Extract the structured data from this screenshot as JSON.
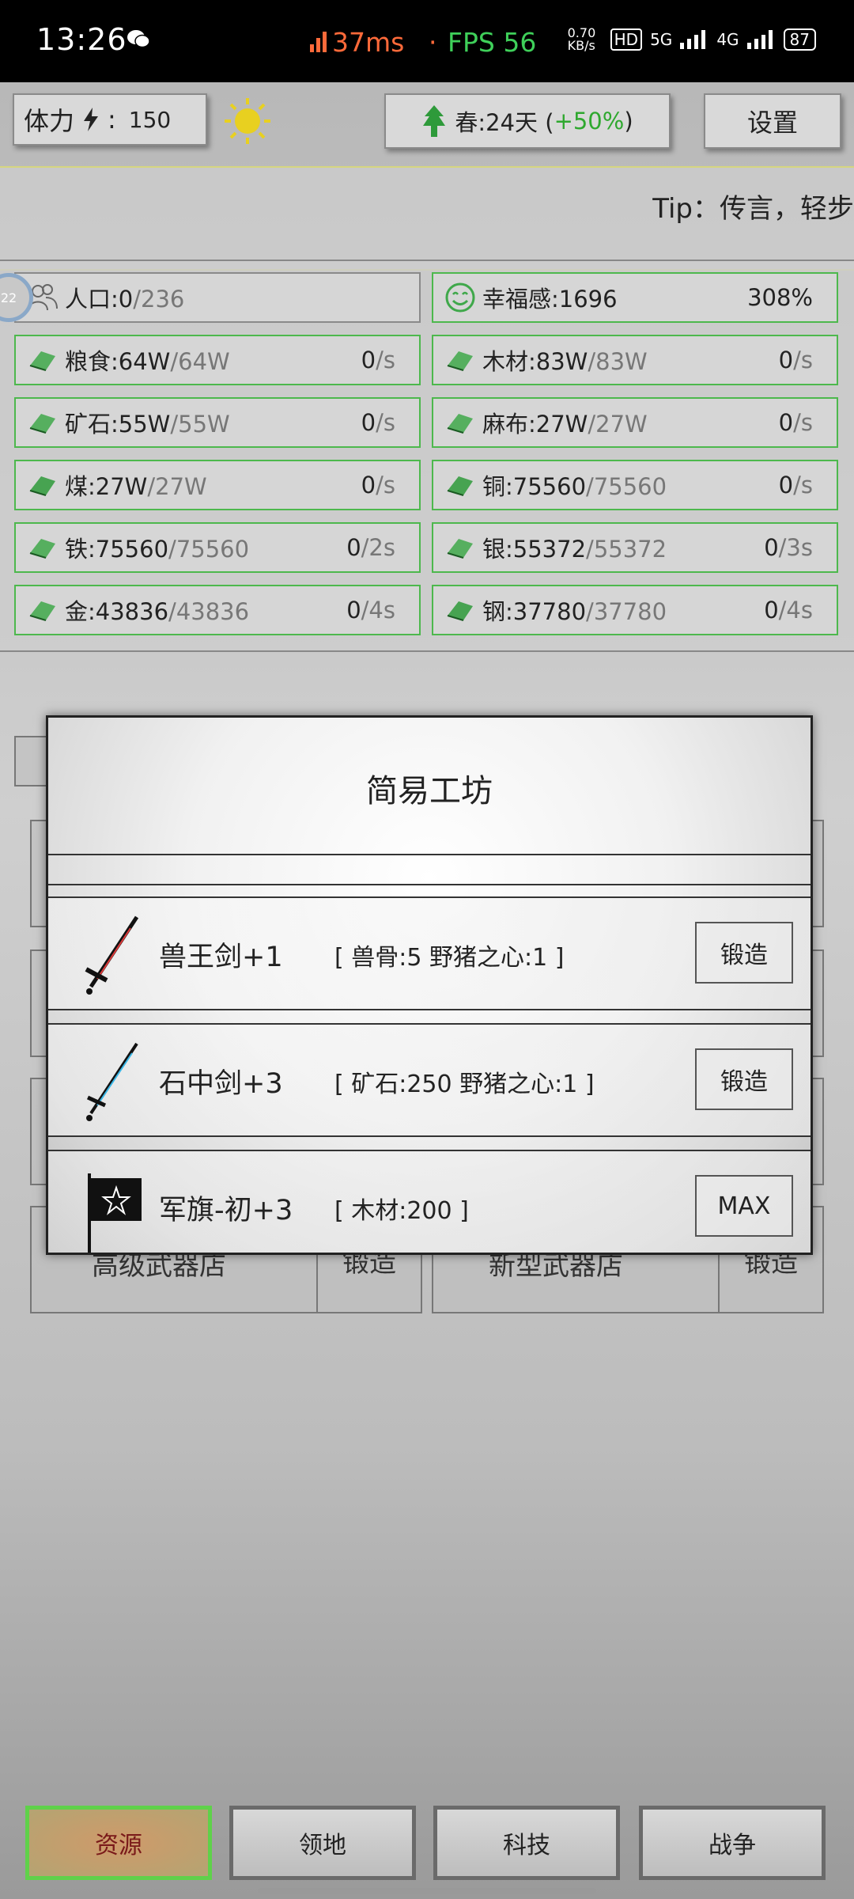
{
  "status_bar": {
    "time": "13:26",
    "ping": "37ms",
    "separator": "·",
    "fps": "FPS 56",
    "net_speed": "0.70 KB/s",
    "hd": "HD",
    "sim1": "5G",
    "sim2": "4G",
    "battery": "87"
  },
  "top": {
    "stamina_label": "体力",
    "stamina_sep": ":",
    "stamina_value": "150",
    "season_label": "春:24天 (",
    "season_bonus": "+50%",
    "season_close": ")",
    "settings": "设置"
  },
  "tip": "Tip：传言，轻步",
  "badge": "22",
  "resources_left": [
    {
      "name": "人口:",
      "cur": "0",
      "max": "/236",
      "rate": "",
      "unit": "",
      "icon": "people-icon"
    },
    {
      "name": "粮食:",
      "cur": "64W",
      "max": "/64W",
      "rate": "0",
      "unit": "/s",
      "icon": "meat-icon"
    },
    {
      "name": "矿石:",
      "cur": "55W",
      "max": "/55W",
      "rate": "0",
      "unit": "/s",
      "icon": "ore-icon"
    },
    {
      "name": "煤:",
      "cur": "27W",
      "max": "/27W",
      "rate": "0",
      "unit": "/s",
      "icon": "coal-icon"
    },
    {
      "name": "铁:",
      "cur": "75560",
      "max": "/75560",
      "rate": "0",
      "unit": "/2s",
      "icon": "iron-icon"
    },
    {
      "name": "金:",
      "cur": "43836",
      "max": "/43836",
      "rate": "0",
      "unit": "/4s",
      "icon": "gold-icon"
    }
  ],
  "resources_right": [
    {
      "name": "幸福感:",
      "cur": "1696",
      "max": "",
      "rate": "308%",
      "unit": "",
      "icon": "smile-icon"
    },
    {
      "name": "木材:",
      "cur": "83W",
      "max": "/83W",
      "rate": "0",
      "unit": "/s",
      "icon": "wood-icon"
    },
    {
      "name": "麻布:",
      "cur": "27W",
      "max": "/27W",
      "rate": "0",
      "unit": "/s",
      "icon": "linen-icon"
    },
    {
      "name": "铜:",
      "cur": "75560",
      "max": "/75560",
      "rate": "0",
      "unit": "/s",
      "icon": "copper-icon"
    },
    {
      "name": "银:",
      "cur": "55372",
      "max": "/55372",
      "rate": "0",
      "unit": "/3s",
      "icon": "silver-icon"
    },
    {
      "name": "钢:",
      "cur": "37780",
      "max": "/37780",
      "rate": "0",
      "unit": "/4s",
      "icon": "steel-icon"
    }
  ],
  "background_shops": {
    "left_label": "高级武器店",
    "left_btn": "锻造",
    "right_label": "新型武器店",
    "right_btn": "锻造"
  },
  "modal": {
    "title": "简易工坊",
    "items": [
      {
        "name": "兽王剑+1",
        "cost": "[ 兽骨:5   野猪之心:1 ]",
        "button": "锻造"
      },
      {
        "name": "石中剑+3",
        "cost": "[ 矿石:250   野猪之心:1 ]",
        "button": "锻造"
      },
      {
        "name": "军旗-初+3",
        "cost": "[ 木材:200 ]",
        "button": "MAX"
      }
    ]
  },
  "nav": [
    "资源",
    "领地",
    "科技",
    "战争"
  ],
  "colors": {
    "accent_green": "#4db84d",
    "ping": "#ff6a3a",
    "fps": "#3fd05a",
    "bonus": "#2fa82f"
  }
}
